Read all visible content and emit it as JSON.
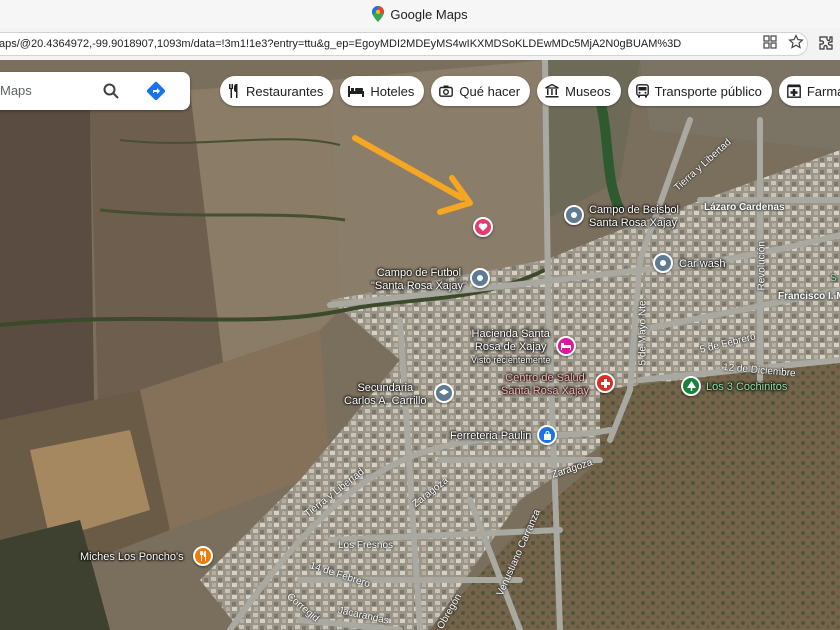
{
  "window": {
    "title": "Google Maps"
  },
  "address_bar": {
    "url": "aps/@20.4364972,-99.9018907,1093m/data=!3m1!1e3?entry=ttu&g_ep=EgoyMDI2MDEyMS4wIKXMDSoKLDEwMDc5MjA2N0gBUAM%3D"
  },
  "search": {
    "placeholder": "Maps"
  },
  "chips": [
    {
      "label": "Restaurantes",
      "icon": "fork-knife-icon"
    },
    {
      "label": "Hoteles",
      "icon": "bed-icon"
    },
    {
      "label": "Qué hacer",
      "icon": "camera-icon"
    },
    {
      "label": "Museos",
      "icon": "museum-icon"
    },
    {
      "label": "Transporte público",
      "icon": "bus-icon"
    },
    {
      "label": "Farmacias",
      "icon": "pharmacy-icon"
    }
  ],
  "places": {
    "beisbol": {
      "line1": "Campo de Beisbol",
      "line2": "Santa Rosa Xajay"
    },
    "futbol": {
      "line1": "Campo de Futbol",
      "line2": "\"Santa Rosa Xajay\""
    },
    "carwash": {
      "line1": "Car wash"
    },
    "hacienda": {
      "line1": "Hacienda Santa",
      "line2": "Rosa de Xajay",
      "sub": "Visto recientemente"
    },
    "secundaria": {
      "line1": "Secundaria",
      "line2": "Carlos A. Carrillo"
    },
    "salud": {
      "line1": "Centro de Salud",
      "line2": "Santa Rosa Xajay"
    },
    "ferreteria": {
      "line1": "Ferreteria Paulin"
    },
    "cochinitos": {
      "line1": "Los 3 Cochinitos"
    },
    "miches": {
      "line1": "Miches Los Poncho's"
    }
  },
  "streets": {
    "tierra_libertad_top": "Tierra y Libertad",
    "lazaro": "Lázaro Cardenas",
    "revolucion": "Revolución",
    "francisco": "Francisco I. M",
    "cinco_mayo": "5 de Mayo Nte.",
    "cinco_febrero": "5 de Febrero",
    "doce_dic": "12 de Diciembre",
    "tierra_libertad_bottom": "Tierra y Libertad",
    "zaragoza1": "Zaragoza",
    "zaragoza2": "Zaragoza",
    "fresnos": "Los Fresnos",
    "catorce_feb": "14 de Febrero",
    "venustiano": "Venustiano Carranza",
    "corregidora": "Corregid",
    "jacarandas": "Jacarandas",
    "obregon": "Obregón",
    "edge_s": "S"
  },
  "colors": {
    "pin_gray": "#5f7a92",
    "pin_pink": "#e8386f",
    "pin_magenta": "#d81b9a",
    "pin_red": "#d93025",
    "pin_blue": "#1a73e8",
    "pin_green": "#188038",
    "pin_orange": "#f57c00",
    "arrow": "#f5a623"
  }
}
